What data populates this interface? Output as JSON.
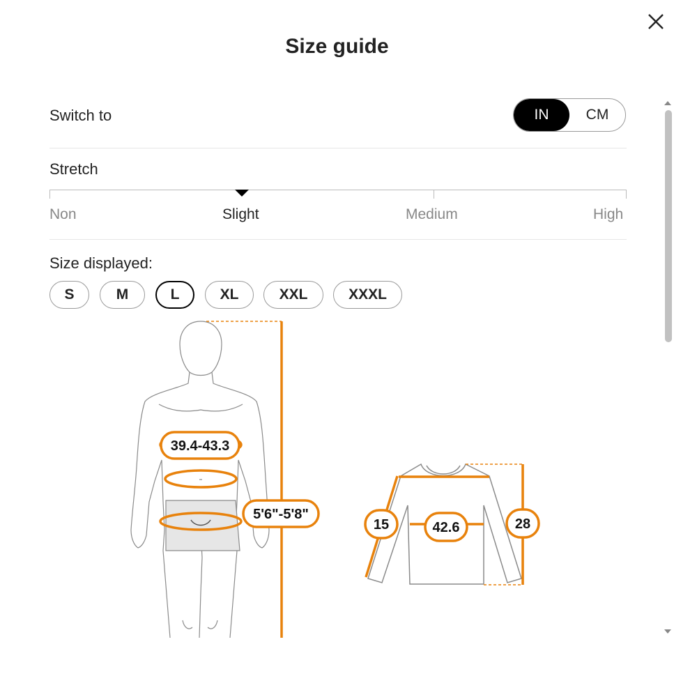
{
  "dialog": {
    "title": "Size guide"
  },
  "unit_switch": {
    "label": "Switch to",
    "options": [
      "IN",
      "CM"
    ],
    "selected": "IN"
  },
  "stretch": {
    "label": "Stretch",
    "levels": [
      "Non",
      "Slight",
      "Medium",
      "High"
    ],
    "selected": "Slight"
  },
  "sizes": {
    "label": "Size displayed:",
    "options": [
      "S",
      "M",
      "L",
      "XL",
      "XXL",
      "XXXL"
    ],
    "selected": "L"
  },
  "body_measurements": {
    "chest": "39.4-43.3",
    "height": "5'6\"-5'8\""
  },
  "garment_measurements": {
    "sleeve": "15",
    "chest": "42.6",
    "length": "28"
  },
  "icons": {
    "close": "close-icon"
  },
  "colors": {
    "accent": "#e8820c",
    "selected": "#000000"
  }
}
